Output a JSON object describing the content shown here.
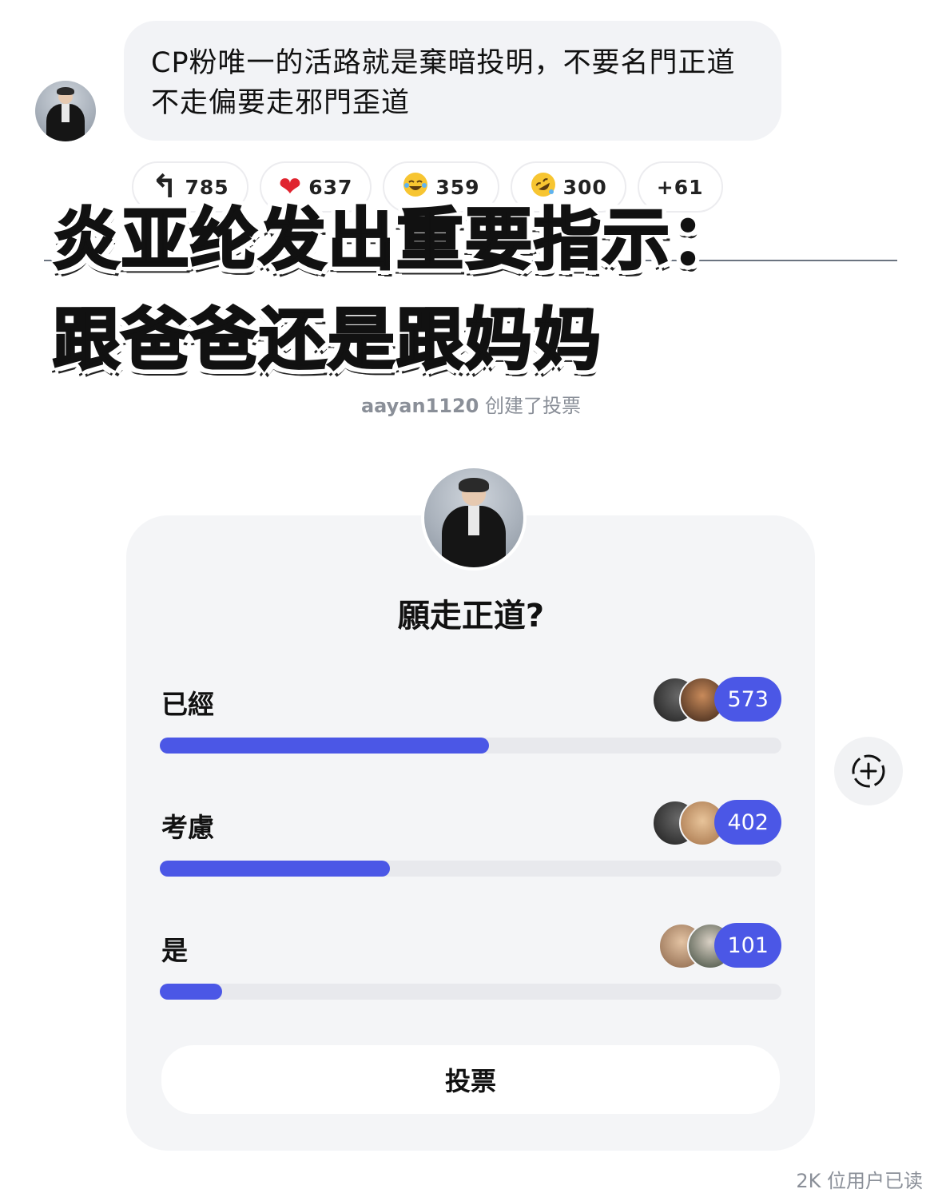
{
  "message": {
    "text": "CP粉唯一的活路就是棄暗投明，不要名門正道不走偏要走邪門歪道"
  },
  "reactions": [
    {
      "icon": "reply-arrow-icon",
      "glyph": "↰",
      "count": "785"
    },
    {
      "icon": "red-heart-icon",
      "glyph": "❤",
      "count": "637"
    },
    {
      "icon": "tears-of-joy-icon",
      "glyph": "😂",
      "count": "359"
    },
    {
      "icon": "rolling-laughing-icon",
      "glyph": "🤣",
      "count": "300"
    },
    {
      "icon": "",
      "glyph": "",
      "count": "+61"
    }
  ],
  "overlay": {
    "line1": "炎亚纶发出重要指示：",
    "line2": "跟爸爸还是跟妈妈"
  },
  "poll_meta": {
    "creator": "aayan1120",
    "action": "创建了投票"
  },
  "poll": {
    "question": "願走正道?",
    "options": [
      {
        "label": "已經",
        "count": "573",
        "fraction": 0.53
      },
      {
        "label": "考慮",
        "count": "402",
        "fraction": 0.37
      },
      {
        "label": "是",
        "count": "101",
        "fraction": 0.1
      }
    ],
    "vote_label": "投票"
  },
  "footer": {
    "read_count": "2K 位用户已读"
  },
  "colors": {
    "accent": "#4b57e6",
    "bubble": "#f2f3f6",
    "card": "#f4f5f7"
  }
}
